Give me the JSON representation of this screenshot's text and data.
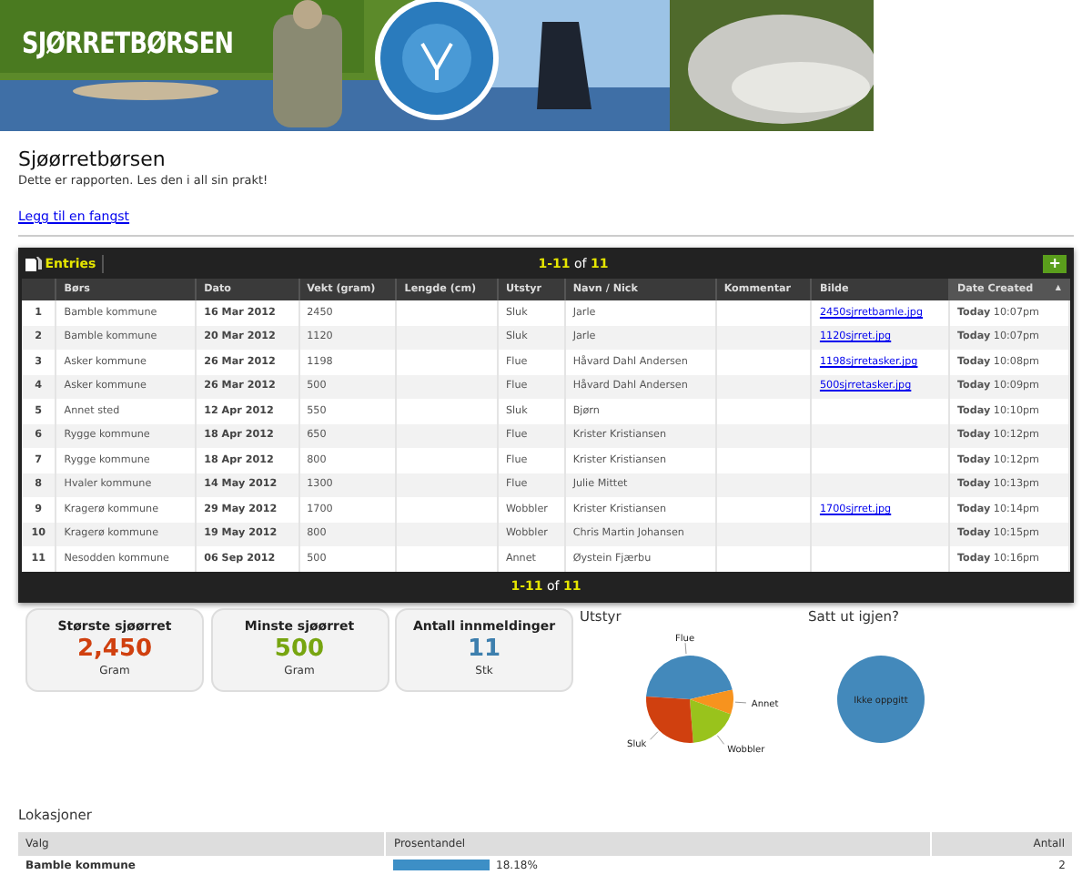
{
  "banner": {
    "title": "SJØRRETBØRSEN",
    "kind": "picture"
  },
  "page": {
    "title": "Sjøørretbørsen",
    "subtitle": "Dette er rapporten. Les den i all sin prakt!",
    "link": "Legg til en fangst"
  },
  "entries": {
    "title": "Entries",
    "top_pager": {
      "range": "1-11",
      "of": "of",
      "total": "11"
    },
    "bottom_pager": {
      "range": "1-11",
      "of": "of",
      "total": "11"
    },
    "add_button": "+",
    "columns": [
      {
        "sorted": false
      },
      {
        "label": "Børs",
        "sorted": false
      },
      {
        "label": "Dato",
        "sorted": false
      },
      {
        "label": "Vekt (gram)",
        "sorted": false
      },
      {
        "label": "Lengde (cm)",
        "sorted": false
      },
      {
        "label": "Utstyr",
        "sorted": false
      },
      {
        "label": "Navn / Nick",
        "sorted": false
      },
      {
        "label": "Kommentar",
        "sorted": false
      },
      {
        "label": "Bilde",
        "sorted": false
      },
      {
        "label": "Date Created",
        "sorted": true,
        "sort_icon": "▲"
      }
    ],
    "rows": [
      {
        "id": "1",
        "bors": "Bamble kommune",
        "dato": "16 Mar 2012",
        "vekt": "2450",
        "utstyr": "Sluk",
        "navn": "Jarle",
        "bilde": "2450sjrretbamle.jpg",
        "day": "Today",
        "time": "10:07pm"
      },
      {
        "id": "2",
        "bors": "Bamble kommune",
        "dato": "20 Mar 2012",
        "vekt": "1120",
        "utstyr": "Sluk",
        "navn": "Jarle",
        "bilde": "1120sjrret.jpg",
        "day": "Today",
        "time": "10:07pm"
      },
      {
        "id": "3",
        "bors": "Asker kommune",
        "dato": "26 Mar 2012",
        "vekt": "1198",
        "utstyr": "Flue",
        "navn": "Håvard Dahl Andersen",
        "bilde": "1198sjrretasker.jpg",
        "day": "Today",
        "time": "10:08pm"
      },
      {
        "id": "4",
        "bors": "Asker kommune",
        "dato": "26 Mar 2012",
        "vekt": "500",
        "utstyr": "Flue",
        "navn": "Håvard Dahl Andersen",
        "bilde": "500sjrretasker.jpg",
        "day": "Today",
        "time": "10:09pm"
      },
      {
        "id": "5",
        "bors": "Annet sted",
        "dato": "12 Apr 2012",
        "vekt": "550",
        "utstyr": "Sluk",
        "navn": "Bjørn",
        "day": "Today",
        "time": "10:10pm"
      },
      {
        "id": "6",
        "bors": "Rygge kommune",
        "dato": "18 Apr 2012",
        "vekt": "650",
        "utstyr": "Flue",
        "navn": "Krister Kristiansen",
        "day": "Today",
        "time": "10:12pm"
      },
      {
        "id": "7",
        "bors": "Rygge kommune",
        "dato": "18 Apr 2012",
        "vekt": "800",
        "utstyr": "Flue",
        "navn": "Krister Kristiansen",
        "day": "Today",
        "time": "10:12pm"
      },
      {
        "id": "8",
        "bors": "Hvaler kommune",
        "dato": "14 May 2012",
        "vekt": "1300",
        "utstyr": "Flue",
        "navn": "Julie Mittet",
        "day": "Today",
        "time": "10:13pm"
      },
      {
        "id": "9",
        "bors": "Kragerø kommune",
        "dato": "29 May 2012",
        "vekt": "1700",
        "utstyr": "Wobbler",
        "navn": "Krister Kristiansen",
        "bilde": "1700sjrret.jpg",
        "day": "Today",
        "time": "10:14pm"
      },
      {
        "id": "10",
        "bors": "Kragerø kommune",
        "dato": "19 May 2012",
        "vekt": "800",
        "utstyr": "Wobbler",
        "navn": "Chris Martin Johansen",
        "day": "Today",
        "time": "10:15pm"
      },
      {
        "id": "11",
        "bors": "Nesodden kommune",
        "dato": "06 Sep 2012",
        "vekt": "500",
        "utstyr": "Annet",
        "navn": "Øystein Fjærbu",
        "day": "Today",
        "time": "10:16pm"
      }
    ]
  },
  "stats": [
    {
      "label": "Største sjøørret",
      "value": "2,450",
      "unit": "Gram",
      "color": "#d0400f"
    },
    {
      "label": "Minste sjøørret",
      "value": "500",
      "unit": "Gram",
      "color": "#77a510"
    },
    {
      "label": "Antall innmeldinger",
      "value": "11",
      "unit": "Stk",
      "color": "#3d7fae"
    }
  ],
  "charts": [
    {
      "title": "Utstyr",
      "chart_data": {
        "type": "pie",
        "categories": [
          "Flue",
          "Annet",
          "Wobbler",
          "Sluk"
        ],
        "series": [
          {
            "values": [
              45.46,
              9.09,
              18.18,
              27.27
            ]
          }
        ],
        "colors": [
          "#4389bb",
          "#f7931e",
          "#99c31c",
          "#d0400f"
        ]
      }
    },
    {
      "title": "Satt ut igjen?",
      "chart_data": {
        "type": "pie",
        "categories": [
          "Ikke oppgitt"
        ],
        "series": [
          {
            "values": [
              100
            ]
          }
        ],
        "colors": [
          "#4389bb"
        ]
      }
    }
  ],
  "locations": {
    "title": "Lokasjoner",
    "columns": [
      "Valg",
      "Prosentandel",
      "Antall"
    ],
    "rows": [
      {
        "valg": "Bamble kommune",
        "level": 0.1818,
        "percent": "18.18%",
        "antall": "2"
      }
    ]
  }
}
